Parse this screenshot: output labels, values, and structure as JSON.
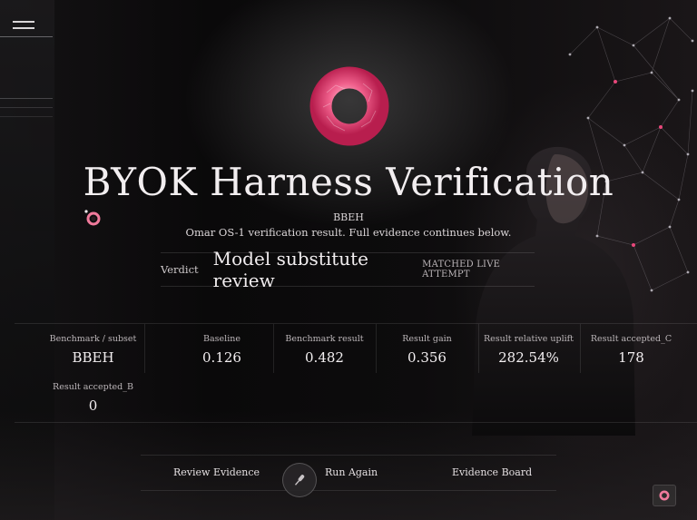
{
  "hero": {
    "title": "BYOK Harness Verification",
    "subtitle": "BBEH",
    "description": "Omar OS-1 verification result. Full evidence continues below."
  },
  "verdict": {
    "label": "Verdict",
    "value": "Model substitute review",
    "badge": "MATCHED LIVE ATTEMPT"
  },
  "metrics": [
    {
      "label": "Benchmark / subset",
      "value": "BBEH"
    },
    {
      "label": "Baseline",
      "value": "0.126"
    },
    {
      "label": "Benchmark result",
      "value": "0.482"
    },
    {
      "label": "Result gain",
      "value": "0.356"
    },
    {
      "label": "Result relative uplift",
      "value": "282.54%"
    },
    {
      "label": "Result accepted_C",
      "value": "178"
    },
    {
      "label": "Result accepted_B",
      "value": "0"
    }
  ],
  "actions": {
    "review": "Review Evidence",
    "run_again": "Run Again",
    "board": "Evidence Board"
  },
  "icons": {
    "menu": "menu-icon",
    "logo": "ring-logo-icon",
    "orb": "orb-icon",
    "mic": "microphone-icon",
    "small": "ring-icon"
  },
  "colors": {
    "accent": "#e8477a",
    "background": "#0b0a0b",
    "text": "#f2eef0"
  }
}
